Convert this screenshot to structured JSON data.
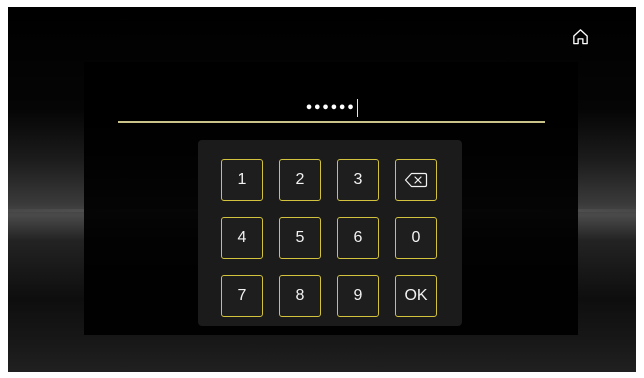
{
  "header": {
    "home_icon": "home-icon"
  },
  "password": {
    "masked_value": "••••••"
  },
  "keypad": {
    "keys": {
      "k1": "1",
      "k2": "2",
      "k3": "3",
      "k4": "4",
      "k5": "5",
      "k6": "6",
      "k0": "0",
      "k7": "7",
      "k8": "8",
      "k9": "9",
      "ok": "OK"
    },
    "backspace_icon": "backspace-icon"
  },
  "colors": {
    "accent": "#d2c23e",
    "underline": "#c9c38a",
    "key_text": "#f2f2f2"
  }
}
